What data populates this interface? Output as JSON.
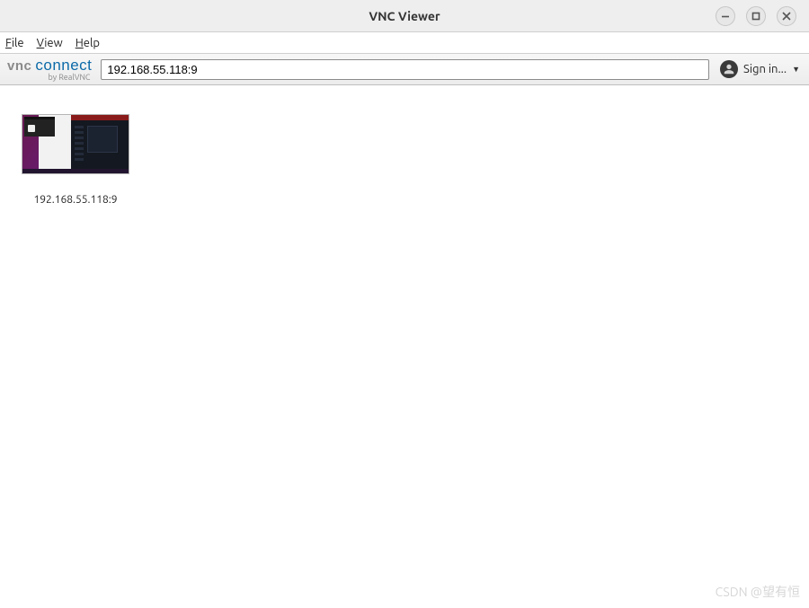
{
  "window": {
    "title": "VNC Viewer"
  },
  "menu": {
    "items": [
      {
        "label": "File",
        "mnemonic_index": 0
      },
      {
        "label": "View",
        "mnemonic_index": 0
      },
      {
        "label": "Help",
        "mnemonic_index": 0
      }
    ]
  },
  "toolbar": {
    "logo": {
      "brand1": "vnc",
      "brand2": "connect",
      "byline": "by RealVNC"
    },
    "address_value": "192.168.55.118:9",
    "signin_label": "Sign in..."
  },
  "connections": [
    {
      "label": "192.168.55.118:9"
    }
  ],
  "watermark": "CSDN @望有恒"
}
